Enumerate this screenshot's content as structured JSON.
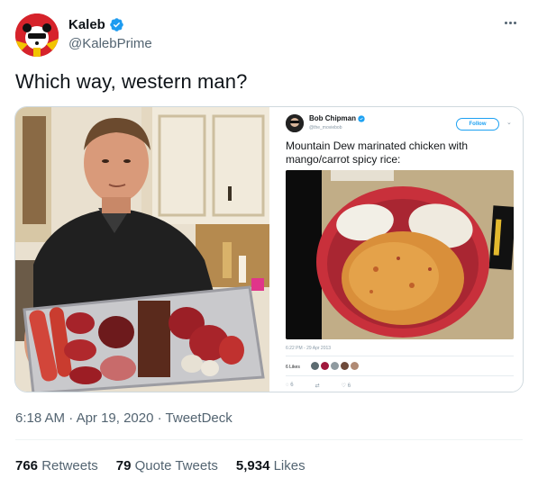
{
  "author": {
    "display_name": "Kaleb",
    "handle": "@KalebPrime",
    "verified": true,
    "avatar_icon": "panda-avatar-icon"
  },
  "tweet": {
    "text": "Which way, western man?"
  },
  "embedded_tweet": {
    "author_name": "Bob Chipman",
    "author_handle": "@the_moviebob",
    "follow_label": "Follow",
    "text": "Mountain Dew marinated chicken with mango/carrot spicy rice:",
    "timestamp": "6:22 PM - 29 Apr 2013",
    "likes_label": "6 Likes",
    "reply_count": "6",
    "like_count": "6"
  },
  "meta": {
    "time": "6:18 AM",
    "separator": "·",
    "date": "Apr 19, 2020",
    "source": "TweetDeck"
  },
  "stats": {
    "retweets_count": "766",
    "retweets_label": "Retweets",
    "quotes_count": "79",
    "quotes_label": "Quote Tweets",
    "likes_count": "5,934",
    "likes_label": "Likes"
  },
  "colors": {
    "verified_blue": "#1d9bf0",
    "text_primary": "#0f1419",
    "text_secondary": "#536471",
    "border": "#cfd9de"
  }
}
